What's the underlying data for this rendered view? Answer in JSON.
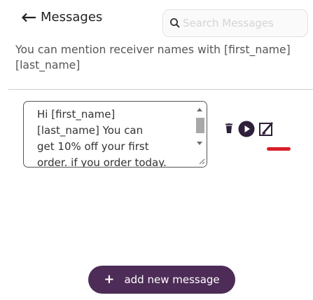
{
  "header": {
    "title": "Messages",
    "back_icon": "left-arrow-icon",
    "search": {
      "placeholder": "Search Messages",
      "value": "",
      "icon": "search-icon"
    }
  },
  "hint": {
    "line1": "You can mention receiver names with [first_name]",
    "line2": "[last_name]"
  },
  "message": {
    "text": "Hi [first_name]\n[last_name] You can\nget 10% off your first\norder. if you order today."
  },
  "actions": {
    "icons": [
      "trash-icon",
      "play-icon",
      "edit-icon"
    ],
    "indicator_color": "#d81f2a"
  },
  "footer": {
    "add_label": "add new message",
    "add_icon": "plus-icon",
    "button_color": "#4d2c57"
  }
}
